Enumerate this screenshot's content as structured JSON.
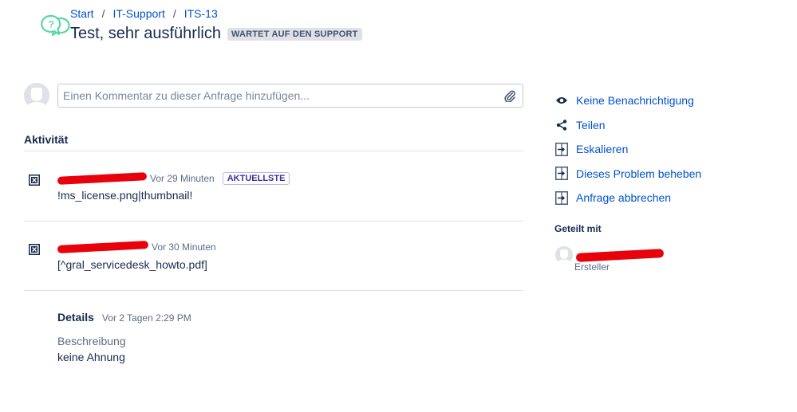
{
  "breadcrumb": {
    "items": [
      {
        "label": "Start"
      },
      {
        "label": "IT-Support"
      },
      {
        "label": "ITS-13"
      }
    ],
    "separator": "/"
  },
  "request": {
    "title": "Test, sehr ausführlich",
    "status": "WARTET AUF DEN SUPPORT"
  },
  "comment": {
    "placeholder": "Einen Kommentar zu dieser Anfrage hinzufügen..."
  },
  "activity": {
    "heading": "Aktivität",
    "items": [
      {
        "time": "Vor 29 Minuten",
        "badge": "AKTUELLSTE",
        "body": "!ms_license.png|thumbnail!"
      },
      {
        "time": "Vor 30 Minuten",
        "badge": "",
        "body": "[^gral_servicedesk_howto.pdf]"
      }
    ]
  },
  "details": {
    "title": "Details",
    "time": "Vor 2 Tagen 2:29 PM",
    "description_label": "Beschreibung",
    "description_value": "keine Ahnung"
  },
  "sidebar": {
    "actions": [
      {
        "label": "Keine Benachrichtigung",
        "icon": "eye-icon"
      },
      {
        "label": "Teilen",
        "icon": "share-icon"
      },
      {
        "label": "Eskalieren",
        "icon": "transition-icon"
      },
      {
        "label": "Dieses Problem beheben",
        "icon": "transition-icon"
      },
      {
        "label": "Anfrage abbrechen",
        "icon": "transition-icon"
      }
    ],
    "shared_heading": "Geteilt mit",
    "shared_users": [
      {
        "role": "Ersteller"
      }
    ]
  },
  "colors": {
    "link": "#0052cc",
    "text": "#172b4d",
    "muted": "#5e6c84",
    "redaction": "#e8000a",
    "logo": "#57d9a3"
  }
}
